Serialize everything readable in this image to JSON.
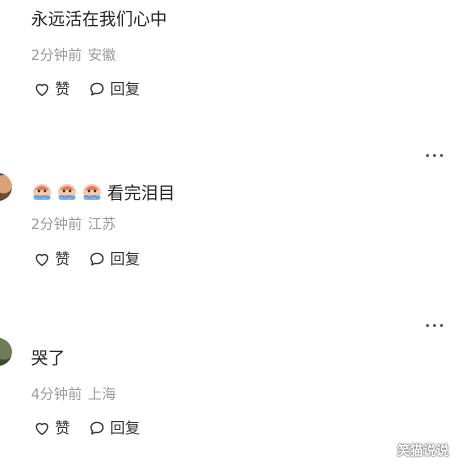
{
  "comments": [
    {
      "text": "永远活在我们心中",
      "time": "2分钟前",
      "location": "安徽",
      "like_label": "赞",
      "reply_label": "回复"
    },
    {
      "text": "看完泪目",
      "emoji": [
        "crying-face-emoji",
        "crying-face-emoji",
        "crying-face-emoji"
      ],
      "time": "2分钟前",
      "location": "江苏",
      "like_label": "赞",
      "reply_label": "回复"
    },
    {
      "text": "哭了",
      "time": "4分钟前",
      "location": "上海",
      "like_label": "赞",
      "reply_label": "回复"
    }
  ],
  "watermark": "笑猫说说",
  "colors": {
    "text": "#222222",
    "meta": "#9a9a9a",
    "icon": "#333333"
  }
}
